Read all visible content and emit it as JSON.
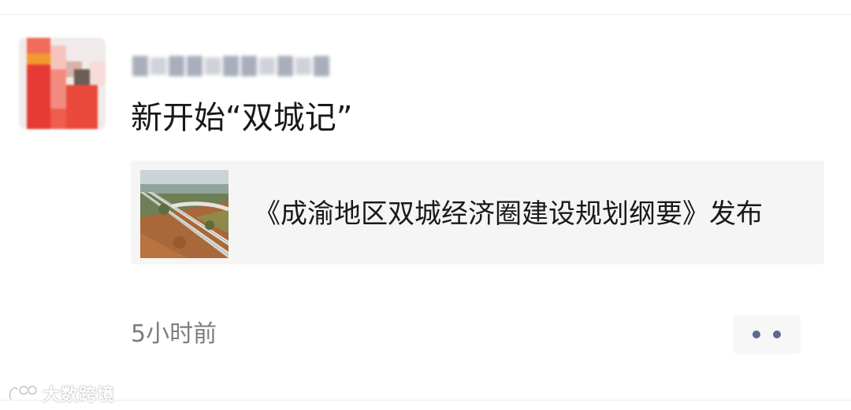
{
  "post": {
    "author_name": "",
    "text": "新开始“双城记”",
    "time": "5小时前"
  },
  "link_card": {
    "title": "《成渝地区双城经济圈建设规划纲要》发布",
    "thumbnail_icon": "highway-photo"
  },
  "actions": {
    "more_icon": "more-dots-icon"
  },
  "watermark": {
    "text": "大数跨境",
    "icon": "brand-logo-icon"
  },
  "colors": {
    "more_dots": "#5b6a91",
    "card_bg": "#f5f5f5",
    "time_text": "#7d7d7d"
  }
}
